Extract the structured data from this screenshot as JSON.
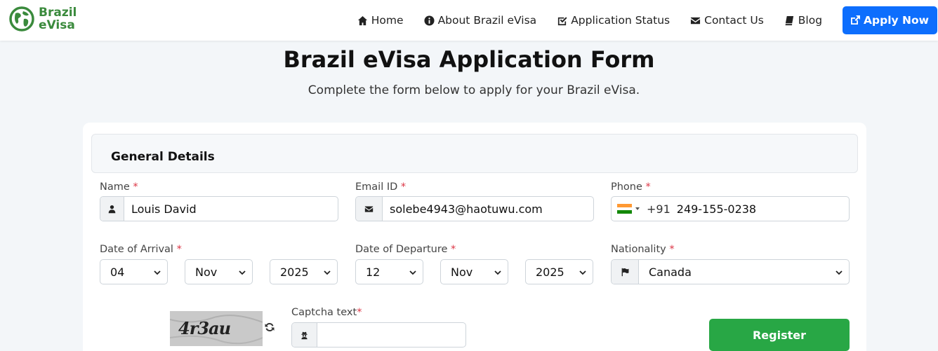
{
  "brand": {
    "line1": "Brazil",
    "line2": "eVisa",
    "color": "#3a8a3c"
  },
  "nav": {
    "items": [
      {
        "label": "Home",
        "icon": "home-icon"
      },
      {
        "label": "About Brazil eVisa",
        "icon": "info-circle-icon"
      },
      {
        "label": "Application Status",
        "icon": "check-square-icon"
      },
      {
        "label": "Contact Us",
        "icon": "envelope-icon"
      },
      {
        "label": "Blog",
        "icon": "book-icon"
      }
    ],
    "apply": {
      "label": "Apply Now",
      "icon": "external-link-icon",
      "color": "#0d6efd"
    }
  },
  "page": {
    "title": "Brazil eVisa Application Form",
    "subtitle": "Complete the form below to apply for your Brazil eVisa."
  },
  "form": {
    "section_title": "General Details",
    "name": {
      "label": "Name",
      "required": "*",
      "value": "Louis David",
      "icon": "user-icon"
    },
    "email": {
      "label": "Email ID",
      "required": "*",
      "value": "solebe4943@haotuwu.com",
      "icon": "envelope-icon"
    },
    "phone": {
      "label": "Phone",
      "required": "*",
      "flag": "india-flag-icon",
      "code": "+91",
      "value": "249-155-0238"
    },
    "arrival": {
      "label": "Date of Arrival",
      "required": "*",
      "day": "04",
      "month": "Nov",
      "year": "2025"
    },
    "departure": {
      "label": "Date of Departure",
      "required": "*",
      "day": "12",
      "month": "Nov",
      "year": "2025"
    },
    "nationality": {
      "label": "Nationality",
      "required": "*",
      "value": "Canada",
      "icon": "flag-icon"
    },
    "captcha": {
      "image_text": "4r3au",
      "label": "Captcha text",
      "required": "*",
      "value": "",
      "icon": "user-secret-icon"
    },
    "register_label": "Register",
    "register_color": "#28a745"
  }
}
